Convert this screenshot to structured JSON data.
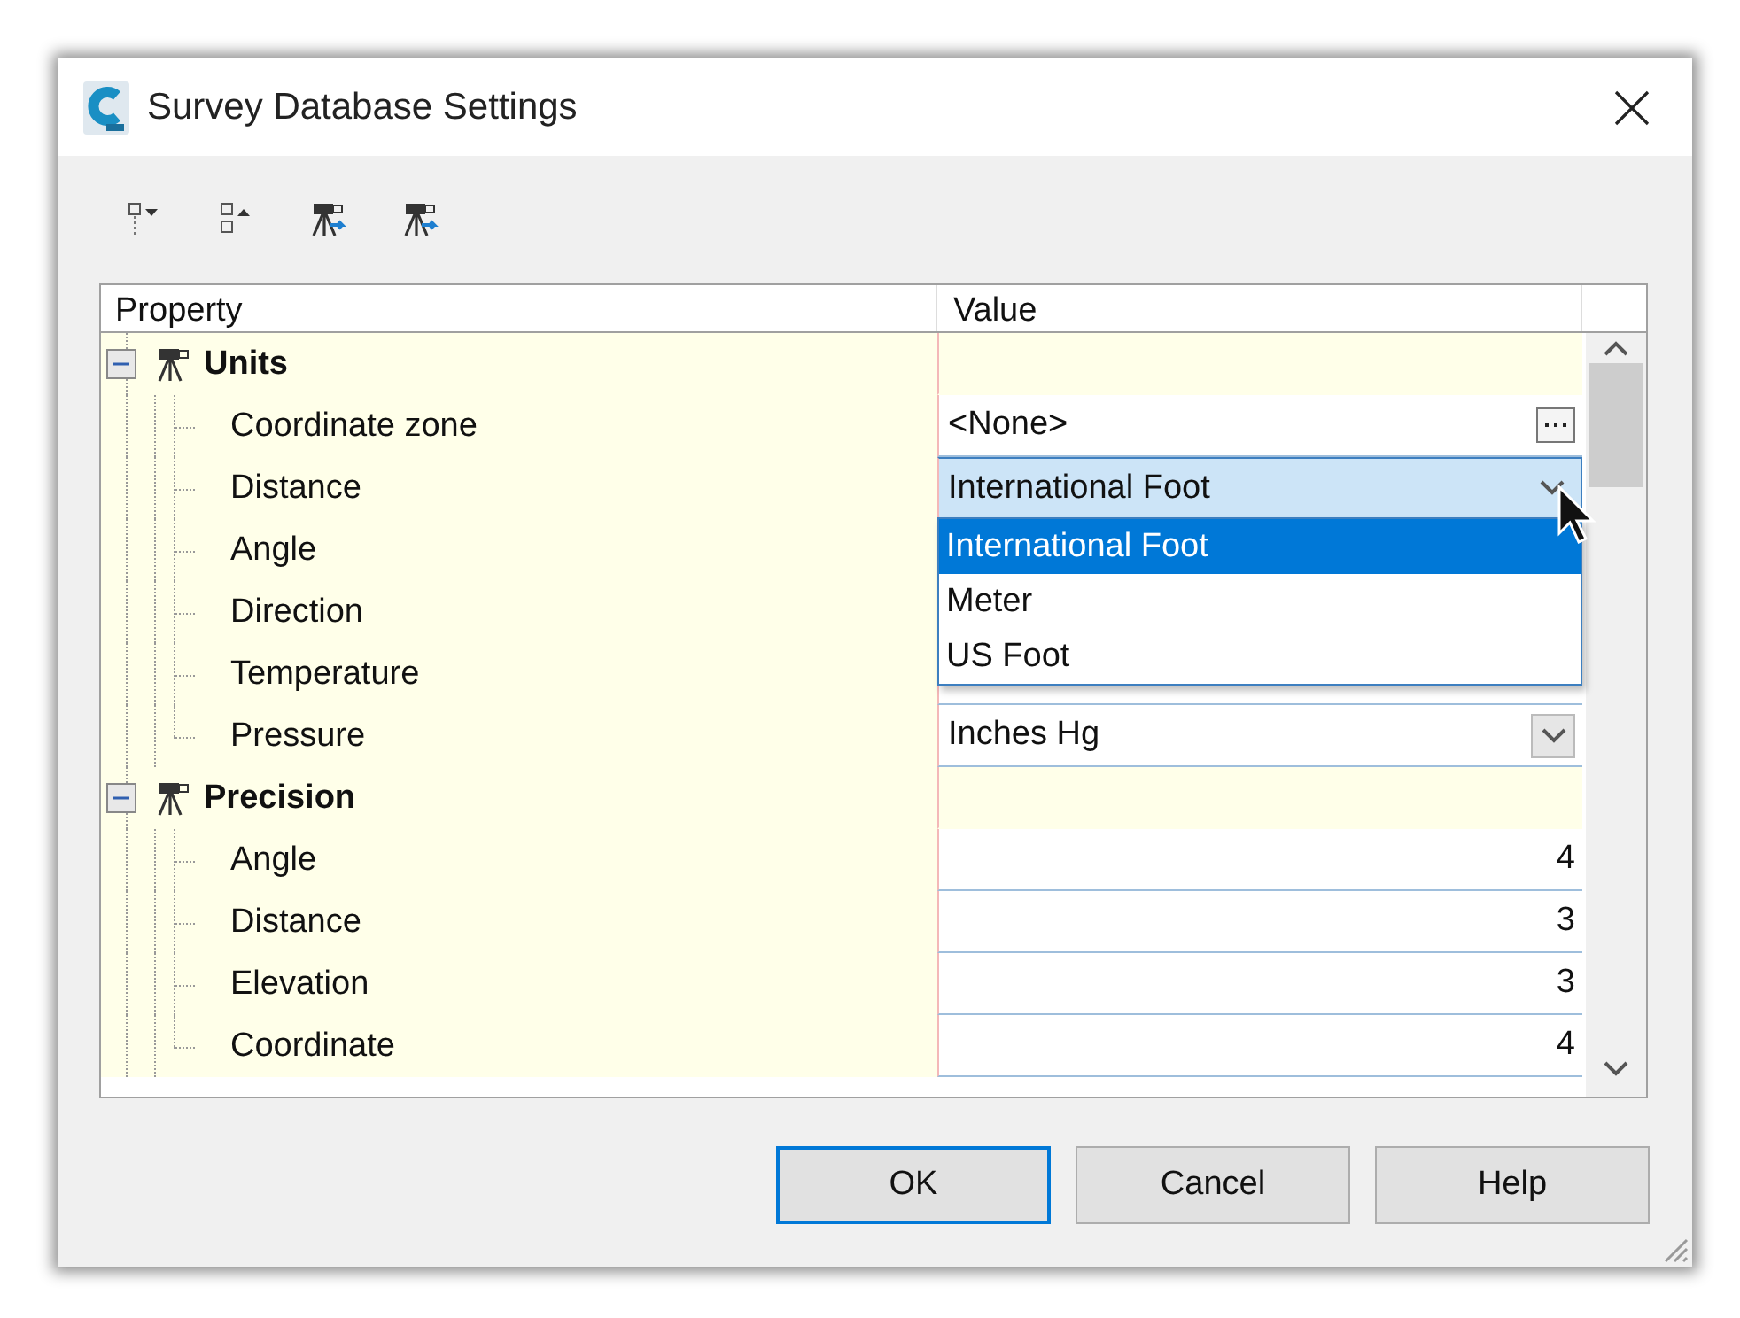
{
  "window": {
    "title": "Survey Database Settings"
  },
  "grid": {
    "columns": [
      "Property",
      "Value"
    ],
    "categories": [
      {
        "name": "Units",
        "expanded": true,
        "rows": [
          {
            "name": "Coordinate zone",
            "kind": "picker",
            "value": "<None>"
          },
          {
            "name": "Distance",
            "kind": "dropdown",
            "value": "International Foot",
            "focused": true,
            "open": true,
            "options": [
              {
                "label": "International Foot",
                "selected": true
              },
              {
                "label": "Meter",
                "selected": false
              },
              {
                "label": "US Foot",
                "selected": false
              }
            ]
          },
          {
            "name": "Angle",
            "kind": "covered"
          },
          {
            "name": "Direction",
            "kind": "covered"
          },
          {
            "name": "Temperature",
            "kind": "covered"
          },
          {
            "name": "Pressure",
            "kind": "dropdown",
            "value": "Inches Hg",
            "focused": false
          }
        ]
      },
      {
        "name": "Precision",
        "expanded": true,
        "rows": [
          {
            "name": "Angle",
            "kind": "number",
            "value": "4"
          },
          {
            "name": "Distance",
            "kind": "number",
            "value": "3"
          },
          {
            "name": "Elevation",
            "kind": "number",
            "value": "3"
          },
          {
            "name": "Coordinate",
            "kind": "number",
            "value": "4"
          }
        ]
      }
    ]
  },
  "buttons": [
    {
      "label": "OK",
      "default": true
    },
    {
      "label": "Cancel",
      "default": false
    },
    {
      "label": "Help",
      "default": false
    }
  ]
}
